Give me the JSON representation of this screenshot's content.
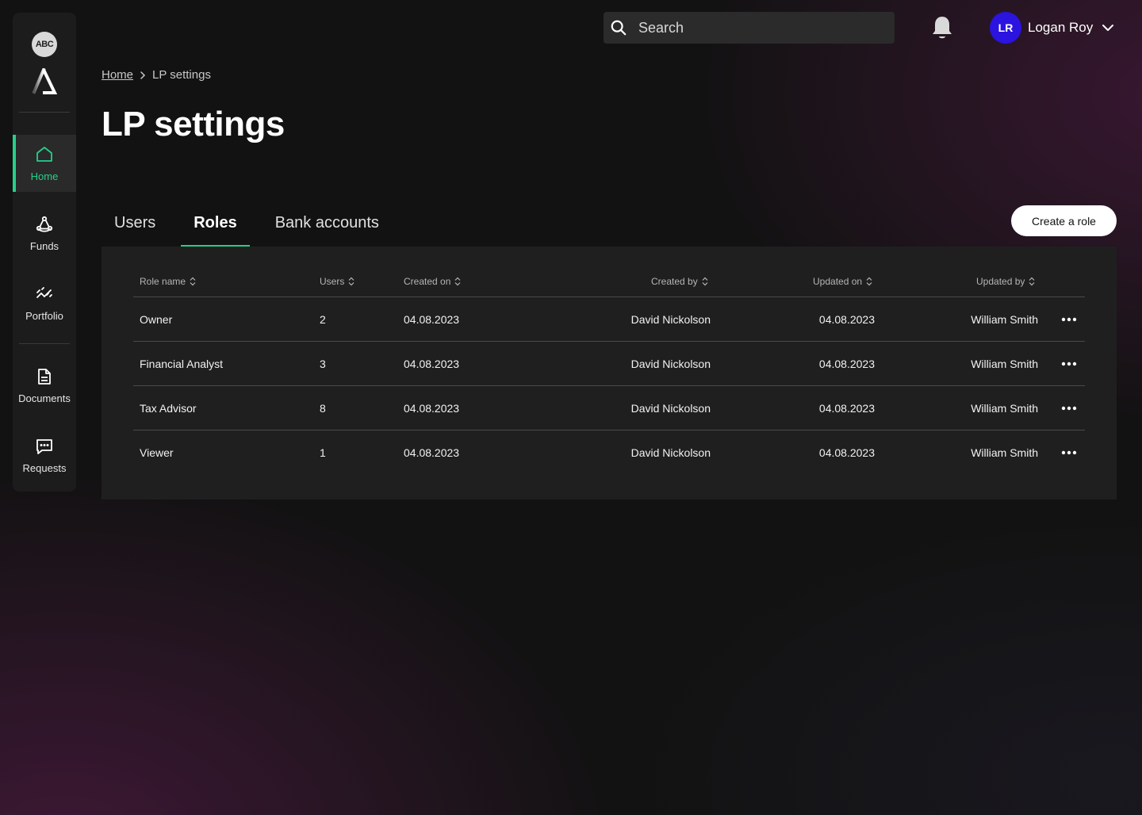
{
  "sidebar": {
    "org_badge": "ABC",
    "logo_icon": "delta-logo-icon",
    "items": [
      {
        "label": "Home",
        "icon": "home-icon",
        "active": true
      },
      {
        "label": "Funds",
        "icon": "funds-icon",
        "active": false
      },
      {
        "label": "Portfolio",
        "icon": "portfolio-icon",
        "active": false
      },
      {
        "label": "Documents",
        "icon": "document-icon",
        "active": false
      },
      {
        "label": "Requests",
        "icon": "chat-icon",
        "active": false
      }
    ]
  },
  "header": {
    "search_placeholder": "Search",
    "notification_icon": "bell-icon",
    "user": {
      "initials": "LR",
      "name": "Logan Roy"
    }
  },
  "breadcrumb": {
    "home": "Home",
    "current": "LP settings"
  },
  "page_title": "LP settings",
  "tabs": [
    {
      "label": "Users",
      "active": false
    },
    {
      "label": "Roles",
      "active": true
    },
    {
      "label": "Bank accounts",
      "active": false
    }
  ],
  "create_button": "Create a role",
  "table": {
    "columns": [
      "Role name",
      "Users",
      "Created on",
      "Created by",
      "Updated on",
      "Updated by"
    ],
    "rows": [
      {
        "role": "Owner",
        "users": "2",
        "created_on": "04.08.2023",
        "created_by": "David Nickolson",
        "updated_on": "04.08.2023",
        "updated_by": "William Smith"
      },
      {
        "role": "Financial Analyst",
        "users": "3",
        "created_on": "04.08.2023",
        "created_by": "David Nickolson",
        "updated_on": "04.08.2023",
        "updated_by": "William Smith"
      },
      {
        "role": "Tax Advisor",
        "users": "8",
        "created_on": "04.08.2023",
        "created_by": "David Nickolson",
        "updated_on": "04.08.2023",
        "updated_by": "William Smith"
      },
      {
        "role": "Viewer",
        "users": "1",
        "created_on": "04.08.2023",
        "created_by": "David Nickolson",
        "updated_on": "04.08.2023",
        "updated_by": "William Smith"
      }
    ]
  },
  "colors": {
    "accent": "#25d08a",
    "avatar": "#2b13e0",
    "background": "#121212",
    "card": "#1f1f1f"
  }
}
